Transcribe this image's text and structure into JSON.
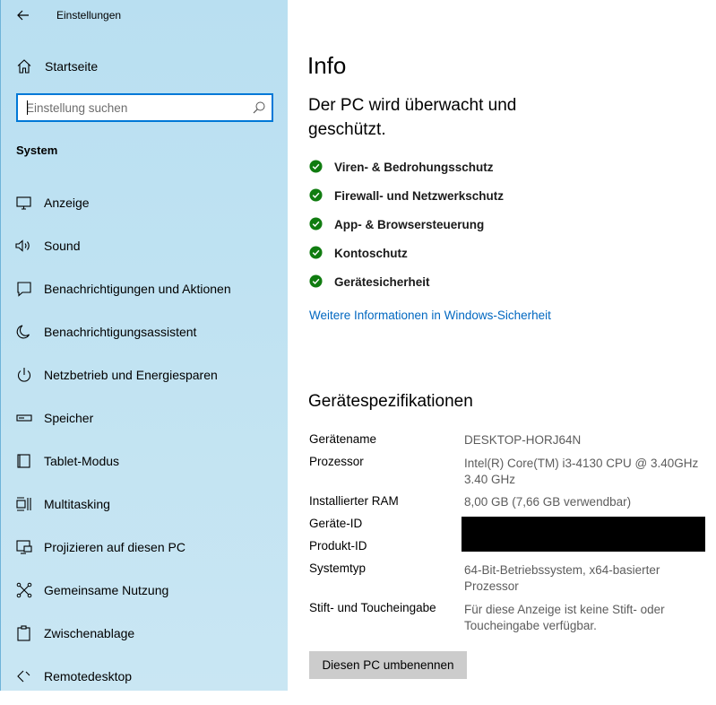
{
  "window": {
    "title": "Einstellungen"
  },
  "sidebar": {
    "home_label": "Startseite",
    "search": {
      "placeholder": "Einstellung suchen"
    },
    "section_title": "System",
    "items": [
      {
        "label": "Anzeige",
        "icon": "monitor-icon"
      },
      {
        "label": "Sound",
        "icon": "speaker-icon"
      },
      {
        "label": "Benachrichtigungen und Aktionen",
        "icon": "notification-icon"
      },
      {
        "label": "Benachrichtigungsassistent",
        "icon": "moon-icon"
      },
      {
        "label": "Netzbetrieb und Energiesparen",
        "icon": "power-icon"
      },
      {
        "label": "Speicher",
        "icon": "storage-icon"
      },
      {
        "label": "Tablet-Modus",
        "icon": "tablet-icon"
      },
      {
        "label": "Multitasking",
        "icon": "multitasking-icon"
      },
      {
        "label": "Projizieren auf diesen PC",
        "icon": "project-icon"
      },
      {
        "label": "Gemeinsame Nutzung",
        "icon": "share-icon"
      },
      {
        "label": "Zwischenablage",
        "icon": "clipboard-icon"
      },
      {
        "label": "Remotedesktop",
        "icon": "remote-icon"
      }
    ]
  },
  "main": {
    "title": "Info",
    "headline": "Der PC wird überwacht und geschützt.",
    "status_items": [
      "Viren- & Bedrohungsschutz",
      "Firewall- und Netzwerkschutz",
      "App- & Browsersteuerung",
      "Kontoschutz",
      "Gerätesicherheit"
    ],
    "status_color": "#107c10",
    "link": "Weitere Informationen in Windows-Sicherheit",
    "specs_title": "Gerätespezifikationen",
    "specs": [
      {
        "key": "Gerätename",
        "value": "DESKTOP-HORJ64N"
      },
      {
        "key": "Prozessor",
        "value": "Intel(R) Core(TM) i3-4130 CPU @ 3.40GHz 3.40 GHz"
      },
      {
        "key": "Installierter RAM",
        "value": "8,00 GB (7,66 GB verwendbar)"
      },
      {
        "key": "Geräte-ID",
        "value": ""
      },
      {
        "key": "Produkt-ID",
        "value": ""
      },
      {
        "key": "Systemtyp",
        "value": "64-Bit-Betriebssystem, x64-basierter Prozessor"
      },
      {
        "key": "Stift- und Toucheingabe",
        "value": "Für diese Anzeige ist keine Stift- oder Toucheingabe verfügbar."
      }
    ],
    "rename_button": "Diesen PC umbenennen"
  },
  "colors": {
    "accent": "#0078d7",
    "link": "#0067c0",
    "button_bg": "#cccccc"
  }
}
